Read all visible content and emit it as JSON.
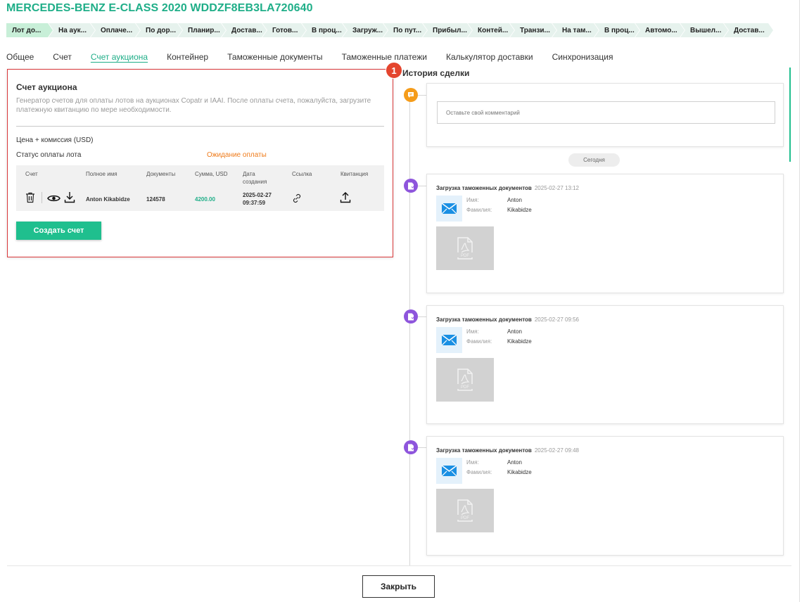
{
  "header": {
    "title": "MERCEDES-BENZ E-CLASS 2020 WDDZF8EB3LA720640"
  },
  "pipeline": {
    "stages": [
      "Лот до...",
      "На аук...",
      "Оплаче...",
      "По дор...",
      "Планир...",
      "Достав...",
      "Готов...",
      "В проц...",
      "Загруж...",
      "По пут...",
      "Прибыл...",
      "Контей...",
      "Транзи...",
      "На там...",
      "В проц...",
      "Автомо...",
      "Вышел...",
      "Достав..."
    ]
  },
  "tabs": [
    "Общее",
    "Счет",
    "Счет аукциона",
    "Контейнер",
    "Таможенные документы",
    "Таможенные платежи",
    "Калькулятор доставки",
    "Синхронизация"
  ],
  "invoice": {
    "title": "Счет аукциона",
    "description": "Генератор счетов для оплаты лотов на аукционах Copatr и IAAI. После оплаты счета, пожалуйста, загрузите платежную квитанцию по мере необходимости.",
    "price_label": "Цена + комиссия (USD)",
    "status_label": "Статус оплаты лота",
    "status_value": "Ожидание оплаты",
    "columns": {
      "invoice": "Счет",
      "full_name": "Полное имя",
      "documents": "Документы",
      "amount": "Сумма, USD",
      "date": "Дата создания",
      "link": "Ссылка",
      "receipt": "Квитанция"
    },
    "row": {
      "full_name": "Anton Kikabidze",
      "documents": "124578",
      "amount": "4200.00",
      "date": "2025-02-27",
      "time": "09:37:59"
    },
    "create_button": "Создать счет"
  },
  "badge": {
    "number": "1"
  },
  "history": {
    "title": "История сделки",
    "comment_placeholder": "Оставьте свой комментарий",
    "today_label": "Сегодня",
    "name_label": "Имя:",
    "surname_label": "Фамилия:",
    "pdf_label": "PDF",
    "events": [
      {
        "title": "Загрузка таможенных документов",
        "timestamp": "2025-02-27 13:12",
        "name": "Anton",
        "surname": "Kikabidze"
      },
      {
        "title": "Загрузка таможенных документов",
        "timestamp": "2025-02-27 09:56",
        "name": "Anton",
        "surname": "Kikabidze"
      },
      {
        "title": "Загрузка таможенных документов",
        "timestamp": "2025-02-27 09:48",
        "name": "Anton",
        "surname": "Kikabidze"
      }
    ]
  },
  "footer": {
    "close_button": "Закрыть"
  },
  "colors": {
    "accent": "#1fae88",
    "button": "#1fbf8e",
    "warning": "#ef7b1a",
    "highlight_border": "#d9383a",
    "event_dot": "#8e55dc",
    "comment_dot": "#f59c1a"
  }
}
